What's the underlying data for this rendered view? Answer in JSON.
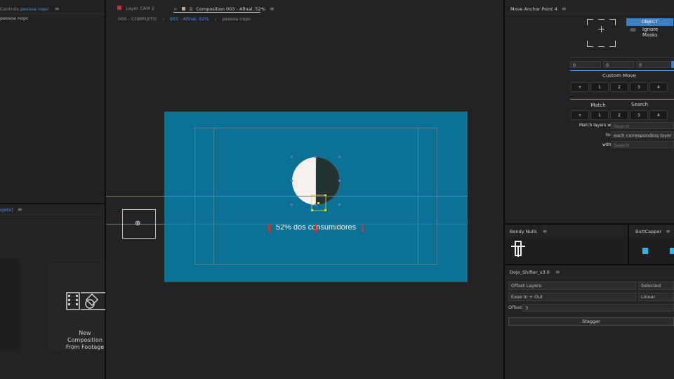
{
  "left_panel": {
    "tab_prefix": "Controls",
    "tab_layer": "pessoa nopc",
    "subheader": "pessoa nopc",
    "project_tab": "ojeto]",
    "new_comp": [
      "New",
      "Composition",
      "From Footage"
    ]
  },
  "viewer": {
    "tab_layer": "Layer  CAM 2",
    "tab_comp": "Composition 003 - Afinal, 52%",
    "nav_items": [
      "000 - COMPLETO",
      "003 - Afinal, 52%",
      "pessoa nopc"
    ],
    "caption": "52% dos consumidores"
  },
  "move_anchor": {
    "title": "Move Anchor Point 4",
    "object_label": "OBJECT",
    "ignore_masks": "Ignore Masks",
    "values": [
      "0",
      "0",
      "0"
    ],
    "custom_move": "Custom Move",
    "row1": [
      "+",
      "1",
      "2",
      "3",
      "4"
    ],
    "match_label": "Match",
    "search_label": "Search",
    "row2": [
      "+",
      "1",
      "2",
      "3",
      "4"
    ],
    "match_layers_with": "Match layers with",
    "search_placeholder": "Search",
    "to_label": "to",
    "each_layer": "each corresponding layer",
    "with_label": "with",
    "with_placeholder": "Search"
  },
  "bendy_nulls": {
    "title": "Bendy Nulls"
  },
  "buttcapper": {
    "title": "ButtCapper"
  },
  "dojo": {
    "title": "Dojo_Shifter_v3.0",
    "offset_layers": "Offset Layers",
    "selected": "Selected",
    "ease": "Ease In + Out",
    "linear": "Linear",
    "offset_label": "Offset:",
    "offset_value": "3",
    "stagger": "Stagger"
  },
  "colors": {
    "comp_bg": "#0b7296",
    "accent_blue": "#4a8fe0",
    "object_btn": "#3e7fc2"
  }
}
